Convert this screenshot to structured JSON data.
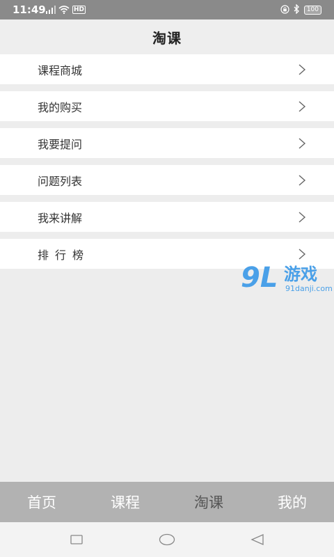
{
  "status_bar": {
    "time": "11:49",
    "hd_label": "HD",
    "battery": "100"
  },
  "header": {
    "title": "淘课"
  },
  "menu": {
    "items": [
      {
        "label": "课程商城"
      },
      {
        "label": "我的购买"
      },
      {
        "label": "我要提问"
      },
      {
        "label": "问题列表"
      },
      {
        "label": "我来讲解"
      },
      {
        "label": "排行榜"
      }
    ]
  },
  "watermark": {
    "mark": "9L",
    "name": "游戏",
    "url": "91danji.com"
  },
  "tabs": [
    {
      "label": "首页"
    },
    {
      "label": "课程"
    },
    {
      "label": "淘课"
    },
    {
      "label": "我的"
    }
  ],
  "colors": {
    "status_bar": "#8a8a8a",
    "page_background": "#ededed",
    "tab_bar": "#b2b2b2",
    "active_tab_text": "#555555",
    "watermark": "#4aa0e8"
  }
}
